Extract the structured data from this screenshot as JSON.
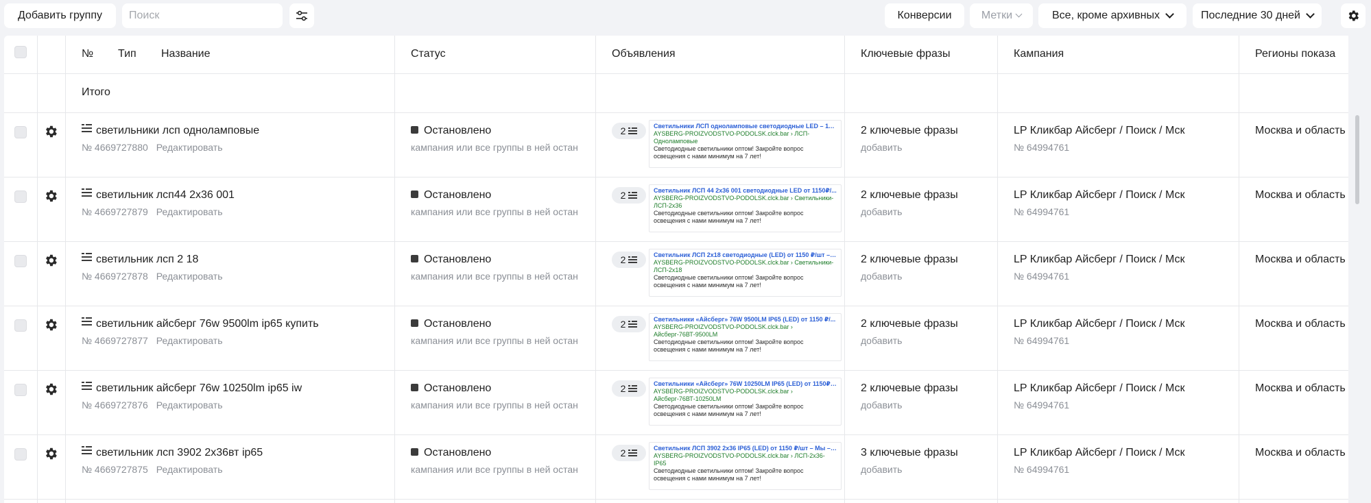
{
  "toolbar": {
    "add_group": "Добавить группу",
    "search_placeholder": "Поиск",
    "filter_icon": "sliders-icon",
    "conversions": "Конверсии",
    "labels": "Метки",
    "archive_filter": "Все, кроме архивных",
    "period": "Последние 30 дней",
    "settings_icon": "gear-icon"
  },
  "columns": {
    "num": "№",
    "type": "Тип",
    "name": "Название",
    "status": "Статус",
    "ads": "Объявления",
    "phrases": "Ключевые фразы",
    "campaign": "Кампания",
    "regions": "Регионы показа"
  },
  "total_label": "Итого",
  "rows": [
    {
      "name": "светильники лсп одноламповые",
      "id": "№ 4669727880",
      "edit": "Редактировать",
      "status": "Остановлено",
      "status_note": "кампания или все группы в ней остан",
      "ad_count": "2",
      "ad_title": "Светильники ЛСП одноламповые светодиодные LED – 115...",
      "ad_url": "AYSBERG-PROIZVODSTVO-PODOLSK.clck.bar › ЛСП-Одноламповые",
      "ad_text": "Светодиодные светильники оптом! Закройте вопрос освещения с нами минимум на 7 лет!",
      "phrases": "2 ключевые фразы",
      "phrases_add": "добавить",
      "campaign": "LP Кликбар Айсберг / Поиск / Мск",
      "campaign_id": "№ 64994761",
      "regions": "Москва и область"
    },
    {
      "name": "светильник лсп44 2х36 001",
      "id": "№ 4669727879",
      "edit": "Редактировать",
      "status": "Остановлено",
      "status_note": "кампания или все группы в ней остан",
      "ad_count": "2",
      "ad_title": "Светильник ЛСП 44 2х36 001 светодиодные LED от 1150₽/...",
      "ad_url": "AYSBERG-PROIZVODSTVO-PODOLSK.clck.bar › Светильники-ЛСП-2х36",
      "ad_text": "Светодиодные светильники оптом! Закройте вопрос освещения с нами минимум на 7 лет!",
      "phrases": "2 ключевые фразы",
      "phrases_add": "добавить",
      "campaign": "LP Кликбар Айсберг / Поиск / Мск",
      "campaign_id": "№ 64994761",
      "regions": "Москва и область"
    },
    {
      "name": "светильник лсп 2 18",
      "id": "№ 4669727878",
      "edit": "Редактировать",
      "status": "Остановлено",
      "status_note": "кампания или все группы в ней остан",
      "ad_count": "2",
      "ad_title": "Светильник ЛСП 2х18 светодиодные (LED) от 1150 ₽/шт – ...",
      "ad_url": "AYSBERG-PROIZVODSTVO-PODOLSK.clck.bar › Светильники-ЛСП-2х18",
      "ad_text": "Светодиодные светильники оптом! Закройте вопрос освещения с нами минимум на 7 лет!",
      "phrases": "2 ключевые фразы",
      "phrases_add": "добавить",
      "campaign": "LP Кликбар Айсберг / Поиск / Мск",
      "campaign_id": "№ 64994761",
      "regions": "Москва и область"
    },
    {
      "name": "светильник айсберг 76w 9500lm ip65 купить",
      "id": "№ 4669727877",
      "edit": "Редактировать",
      "status": "Остановлено",
      "status_note": "кампания или все группы в ней остан",
      "ad_count": "2",
      "ad_title": "Светильники «Айсберг» 76W 9500LM IP65 (LED) от 1150 ₽/...",
      "ad_url": "AYSBERG-PROIZVODSTVO-PODOLSK.clck.bar › Айсберг-76ВТ-9500LM",
      "ad_text": "Светодиодные светильники оптом! Закройте вопрос освещения с нами минимум на 7 лет!",
      "phrases": "2 ключевые фразы",
      "phrases_add": "добавить",
      "campaign": "LP Кликбар Айсберг / Поиск / Мск",
      "campaign_id": "№ 64994761",
      "regions": "Москва и область"
    },
    {
      "name": "светильник айсберг 76w 10250lm ip65 iw",
      "id": "№ 4669727876",
      "edit": "Редактировать",
      "status": "Остановлено",
      "status_note": "кампания или все группы в ней остан",
      "ad_count": "2",
      "ad_title": "Светильники «Айсберг» 76W 10250LM IP65 (LED) от 1150₽/...",
      "ad_url": "AYSBERG-PROIZVODSTVO-PODOLSK.clck.bar › Айсберг-76ВТ-10250LM",
      "ad_text": "Светодиодные светильники оптом! Закройте вопрос освещения с нами минимум на 7 лет!",
      "phrases": "2 ключевые фразы",
      "phrases_add": "добавить",
      "campaign": "LP Кликбар Айсберг / Поиск / Мск",
      "campaign_id": "№ 64994761",
      "regions": "Москва и область"
    },
    {
      "name": "светильник лсп 3902 2х36вт ip65",
      "id": "№ 4669727875",
      "edit": "Редактировать",
      "status": "Остановлено",
      "status_note": "кампания или все группы в ней остан",
      "ad_count": "2",
      "ad_title": "Светильник ЛСП 3902 2х36 IP65 (LED) от 1150 ₽/шт – Мы – ...",
      "ad_url": "AYSBERG-PROIZVODSTVO-PODOLSK.clck.bar › ЛСП-2х36-IP65",
      "ad_text": "Светодиодные светильники оптом! Закройте вопрос освещения с нами минимум на 7 лет!",
      "phrases": "3 ключевые фразы",
      "phrases_add": "добавить",
      "campaign": "LP Кликбар Айсберг / Поиск / Мск",
      "campaign_id": "№ 64994761",
      "regions": "Москва и область"
    }
  ]
}
